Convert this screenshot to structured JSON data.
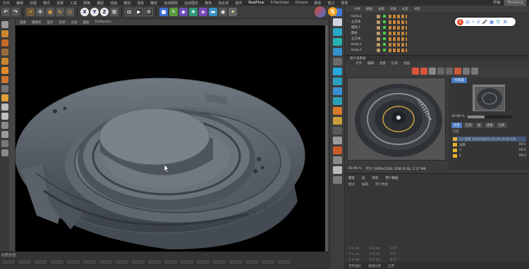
{
  "menubar": {
    "items": [
      "文件",
      "编辑",
      "创建",
      "模式",
      "选择",
      "工具",
      "网格",
      "捕捉",
      "动画",
      "模拟",
      "渲染",
      "雕刻",
      "运动跟踪",
      "运动图形",
      "角色",
      "流水线",
      "插件",
      "RealFlow",
      "X-Particles",
      "Octane",
      "脚本",
      "窗口",
      "帮助"
    ],
    "right_label": "界面",
    "layout": "Modeling"
  },
  "toolbar": {
    "axis_x": "X",
    "axis_y": "Y",
    "axis_z": "Z",
    "s_badge": "S",
    "icons": [
      "undo-icon",
      "redo-icon",
      "select-icon",
      "move-icon",
      "scale-icon",
      "rotate-icon",
      "recent-icon",
      "render-icon",
      "render-view-icon",
      "render-settings-icon",
      "cube-icon",
      "pen-icon",
      "subdivision-icon",
      "array-icon",
      "deformer-icon",
      "floor-icon",
      "camera-icon",
      "light-icon",
      "material-icon"
    ]
  },
  "viewport": {
    "menu": [
      "查看",
      "摄像机",
      "显示",
      "选项",
      "过滤",
      "面板",
      "ProRender"
    ]
  },
  "timeline": {
    "label": "材质管理"
  },
  "object_manager": {
    "menu": [
      "文件",
      "编辑",
      "查看",
      "对象",
      "标签",
      "书签"
    ],
    "objects": [
      "body.2",
      "立方体",
      "圆柱.1",
      "圆柱",
      "立方体",
      "body.1",
      "body.1"
    ]
  },
  "ime": {
    "s": "S",
    "glyphs": [
      "中",
      "•",
      "⊙",
      "🎤",
      "▦",
      "👕",
      "⌘"
    ]
  },
  "picture_viewer": {
    "title": "图片查看器",
    "menu": [
      "文件",
      "编辑",
      "查看",
      "比较",
      "动画"
    ],
    "nav_tab": "导航器",
    "zoom_text": "40.96 %",
    "zoom_fraction": 0.4,
    "info_zoom": "40.96 %",
    "info_size": "尺寸: 1600x1200, RGB (8 位), 2.27 MB",
    "history_tabs": [
      "历史",
      "信息",
      "层",
      "滤镜",
      "立体"
    ],
    "history_label": "历史",
    "history_items": [
      {
        "name": "C4 渲染 2021/10/20 15:35 (0:00:14)"
      },
      {
        "name": "渲染"
      },
      {
        "name": "1"
      },
      {
        "name": "1"
      }
    ],
    "history_values": [
      "",
      "00:1",
      "00:1",
      "00:1"
    ]
  },
  "bottom_panel": {
    "tabs": [
      "属性",
      "层",
      "构造",
      "用户数据"
    ],
    "menu": [
      "模式",
      "编辑",
      "用户数据"
    ],
    "coords": [
      {
        "a": "X 0 cm",
        "b": "X 0 cm",
        "c": "H 0°"
      },
      {
        "a": "Y 0 cm",
        "b": "Y 0 cm",
        "c": "P 0°"
      },
      {
        "a": "Z 0 cm",
        "b": "Z 0 cm",
        "c": "B 0°"
      }
    ],
    "footer": [
      "世界坐标",
      "缩放比例",
      "应用"
    ]
  },
  "colors": {
    "accent": "#4a79c2",
    "object_check": "#4ad24a"
  }
}
